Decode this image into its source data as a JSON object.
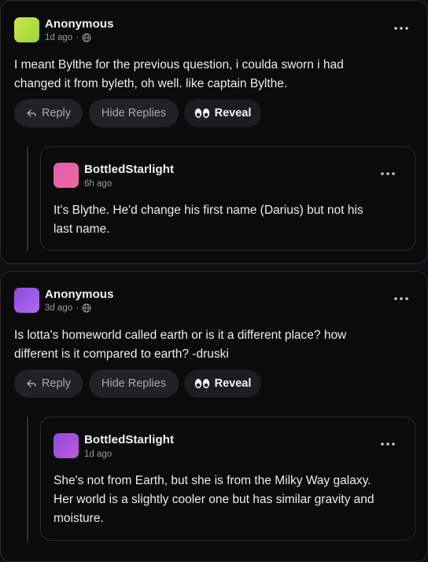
{
  "threads": [
    {
      "comment": {
        "author": "Anonymous",
        "time": "1d ago",
        "dot": "·",
        "body_lines": [
          "I meant Bylthe for the previous question, i coulda sworn i had",
          "changed it from byleth, oh well. like captain Bylthe."
        ],
        "avatar_gradient": [
          "#c9e64a",
          "#9bd43a"
        ]
      },
      "actions": {
        "reply": "Reply",
        "hide": "Hide Replies",
        "reveal": "Reveal"
      },
      "reply": {
        "author": "BottledStarlight",
        "time": "6h ago",
        "body_lines": [
          "It's Blythe. He'd change his first name (Darius) but not his",
          "last name."
        ],
        "avatar_gradient": [
          "#e05bb5",
          "#f06a9a"
        ]
      }
    },
    {
      "comment": {
        "author": "Anonymous",
        "time": "3d ago",
        "dot": "·",
        "body_lines": [
          "Is lotta's homeworld called earth or is it a different place? how",
          "different is it compared to earth? -druski"
        ],
        "avatar_gradient": [
          "#8a4be0",
          "#b06af0"
        ]
      },
      "actions": {
        "reply": "Reply",
        "hide": "Hide Replies",
        "reveal": "Reveal"
      },
      "reply": {
        "author": "BottledStarlight",
        "time": "1d ago",
        "body_lines": [
          "She's not from Earth, but she is from the Milky Way galaxy.",
          "Her world is a slightly cooler one but has similar gravity and",
          "moisture."
        ],
        "avatar_gradient": [
          "#8a4be0",
          "#c25ad8"
        ]
      }
    }
  ],
  "icons": {
    "more": "more-dots-icon",
    "globe": "globe-icon",
    "reply": "reply-arrow-icon",
    "reveal": "eyes-icon"
  }
}
